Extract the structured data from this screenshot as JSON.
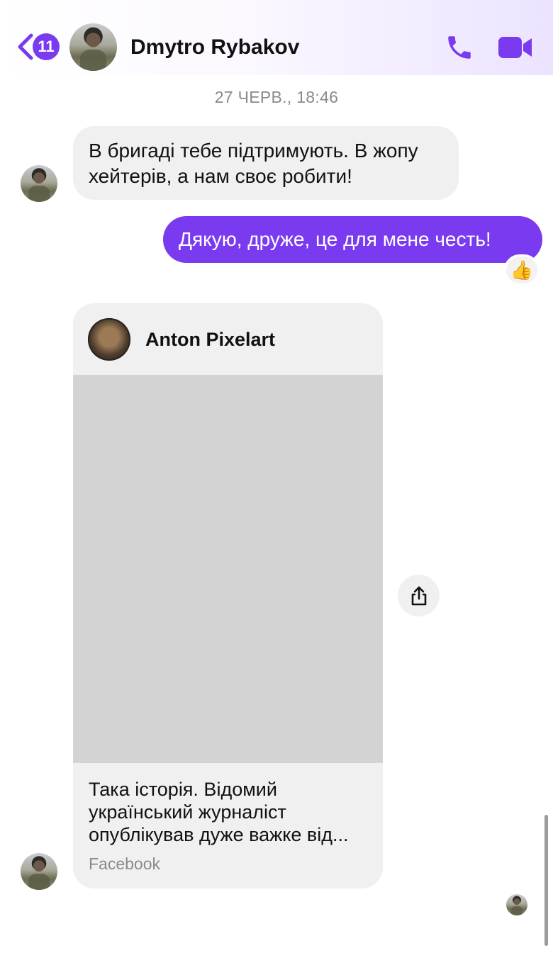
{
  "header": {
    "back_icon": "chevron-left-icon",
    "unread_count": "11",
    "contact_name": "Dmytro Rybakov",
    "call_icon": "phone-icon",
    "video_icon": "video-camera-icon",
    "accent_color": "#7a3bf0"
  },
  "conversation": {
    "timestamp": "27 ЧЕРВ., 18:46",
    "incoming_message": "В бригаді тебе підтримують. В жопу хейтерів, а нам своє робити!",
    "outgoing_message": "Дякую, друже, це для мене честь!",
    "reaction": "👍",
    "shared_post": {
      "author": "Anton Pixelart",
      "text": "Така історія. Відомий український журналіст опублікував дуже важке від...",
      "source": "Facebook"
    },
    "share_icon": "share-icon"
  }
}
